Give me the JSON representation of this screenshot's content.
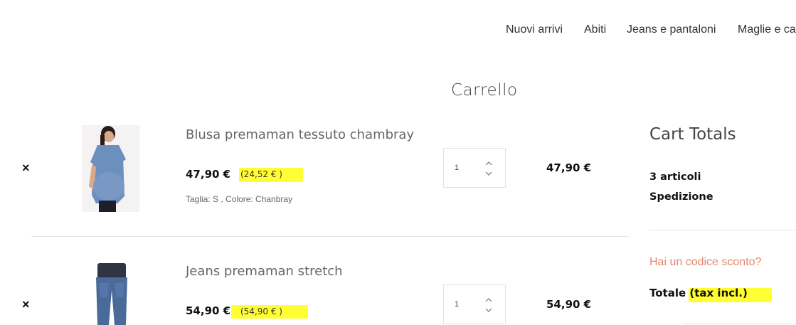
{
  "nav": {
    "items": [
      {
        "label": "Nuovi arrivi"
      },
      {
        "label": "Abiti"
      },
      {
        "label": "Jeans e pantaloni"
      },
      {
        "label": "Maglie e ca"
      }
    ]
  },
  "page": {
    "title": "Carrello"
  },
  "cart": {
    "remove_label": "×",
    "items": [
      {
        "name": "Blusa premaman tessuto chambray",
        "price": "47,90 €",
        "tax_note": "(24,52 € )",
        "attributes": "Taglia: S , Colore: Chanbray",
        "quantity": "1",
        "subtotal": "47,90 €"
      },
      {
        "name": "Jeans premaman stretch",
        "price": "54,90 €",
        "tax_note": "(54,90 € )",
        "attributes": "",
        "quantity": "1",
        "subtotal": "54,90 €"
      }
    ]
  },
  "totals": {
    "title": "Cart Totals",
    "items_count": "3 articoli",
    "shipping_label": "Spedizione",
    "coupon_link": "Hai un codice sconto?",
    "total_label": "Totale",
    "tax_label": "(tax incl.)"
  },
  "colors": {
    "highlight": "#ffff33",
    "coupon_link": "#e8856b"
  },
  "icons": {
    "remove": "close-icon",
    "qty_up": "chevron-up-icon",
    "qty_down": "chevron-down-icon"
  }
}
